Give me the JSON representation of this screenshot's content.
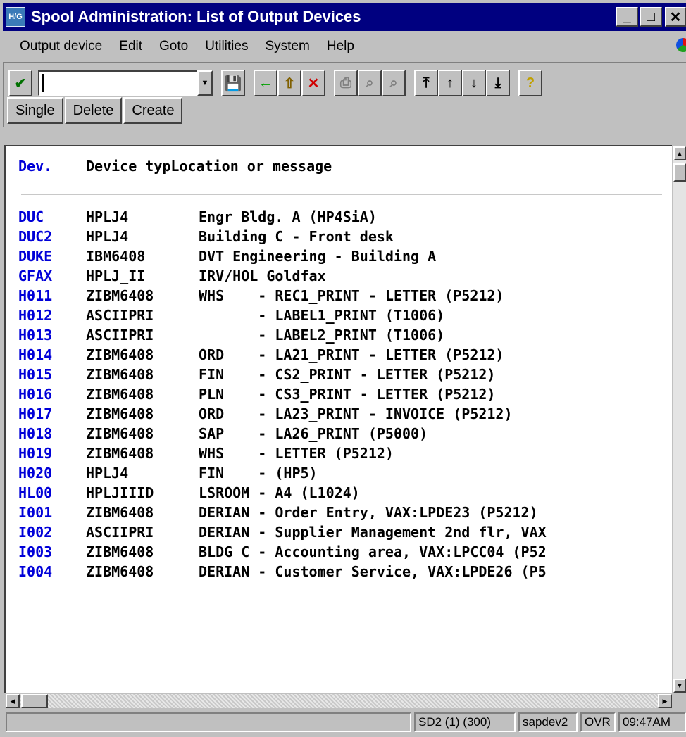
{
  "window": {
    "app_icon_text": "H/G",
    "title": "Spool Administration: List of Output Devices",
    "minimize": "_",
    "maximize": "□",
    "close": "✕"
  },
  "menu": [
    {
      "first": "O",
      "rest": "utput device"
    },
    {
      "pre": "E",
      "mid": "d",
      "rest": "it",
      "first": ""
    },
    {
      "first": "G",
      "rest": "oto"
    },
    {
      "first": "U",
      "rest": "tilities"
    },
    {
      "pre": "S",
      "mid": "y",
      "rest": "stem",
      "first": ""
    },
    {
      "first": "H",
      "rest": "elp"
    }
  ],
  "toolbar": {
    "command_value": "",
    "icons": [
      {
        "name": "enter-check-icon",
        "glyph": "✔"
      },
      {
        "name": "save-icon",
        "glyph": "💾"
      },
      {
        "name": "back-icon",
        "glyph": "←"
      },
      {
        "name": "exit-up-icon",
        "glyph": "⇧"
      },
      {
        "name": "cancel-icon",
        "glyph": "✕"
      },
      {
        "name": "print-icon",
        "glyph": "⎙"
      },
      {
        "name": "find-icon",
        "glyph": "⌕"
      },
      {
        "name": "find-next-icon",
        "glyph": "⌕"
      },
      {
        "name": "first-page-icon",
        "glyph": "⤒"
      },
      {
        "name": "previous-page-icon",
        "glyph": "↑"
      },
      {
        "name": "next-page-icon",
        "glyph": "↓"
      },
      {
        "name": "last-page-icon",
        "glyph": "⤓"
      },
      {
        "name": "help-icon",
        "glyph": "?"
      }
    ]
  },
  "app_buttons": {
    "single": "Single",
    "delete": "Delete",
    "create": "Create"
  },
  "list": {
    "header": {
      "col1": "Dev.",
      "col2": "Device typLocation or message"
    },
    "rows": [
      {
        "dev": "DUC",
        "type": "HPLJ4",
        "loc": "Engr Bldg. A (HP4SiA)"
      },
      {
        "dev": "DUC2",
        "type": "HPLJ4",
        "loc": "Building C - Front desk"
      },
      {
        "dev": "DUKE",
        "type": "IBM6408",
        "loc": "DVT Engineering - Building A"
      },
      {
        "dev": "GFAX",
        "type": "HPLJ_II",
        "loc": "IRV/HOL Goldfax"
      },
      {
        "dev": "H011",
        "type": "ZIBM6408",
        "loc": "WHS    - REC1_PRINT - LETTER (P5212)"
      },
      {
        "dev": "H012",
        "type": "ASCIIPRI",
        "loc": "       - LABEL1_PRINT (T1006)"
      },
      {
        "dev": "H013",
        "type": "ASCIIPRI",
        "loc": "       - LABEL2_PRINT (T1006)"
      },
      {
        "dev": "H014",
        "type": "ZIBM6408",
        "loc": "ORD    - LA21_PRINT - LETTER (P5212)"
      },
      {
        "dev": "H015",
        "type": "ZIBM6408",
        "loc": "FIN    - CS2_PRINT - LETTER (P5212)"
      },
      {
        "dev": "H016",
        "type": "ZIBM6408",
        "loc": "PLN    - CS3_PRINT - LETTER (P5212)"
      },
      {
        "dev": "H017",
        "type": "ZIBM6408",
        "loc": "ORD    - LA23_PRINT - INVOICE (P5212)"
      },
      {
        "dev": "H018",
        "type": "ZIBM6408",
        "loc": "SAP    - LA26_PRINT (P5000)"
      },
      {
        "dev": "H019",
        "type": "ZIBM6408",
        "loc": "WHS    - LETTER (P5212)"
      },
      {
        "dev": "H020",
        "type": "HPLJ4",
        "loc": "FIN    - (HP5)"
      },
      {
        "dev": "HL00",
        "type": "HPLJIIID",
        "loc": "LSROOM - A4 (L1024)"
      },
      {
        "dev": "I001",
        "type": "ZIBM6408",
        "loc": "DERIAN - Order Entry, VAX:LPDE23 (P5212)"
      },
      {
        "dev": "I002",
        "type": "ASCIIPRI",
        "loc": "DERIAN - Supplier Management 2nd flr, VAX"
      },
      {
        "dev": "I003",
        "type": "ZIBM6408",
        "loc": "BLDG C - Accounting area, VAX:LPCC04 (P52"
      },
      {
        "dev": "I004",
        "type": "ZIBM6408",
        "loc": "DERIAN - Customer Service, VAX:LPDE26 (P5"
      }
    ]
  },
  "status": {
    "message": "",
    "system": "SD2 (1) (300)",
    "server": "sapdev2",
    "mode": "OVR",
    "time": "09:47AM"
  },
  "colors": {
    "title_bar": "#000080",
    "device_name": "#0000d8",
    "window_bg": "#c0c0c0"
  }
}
